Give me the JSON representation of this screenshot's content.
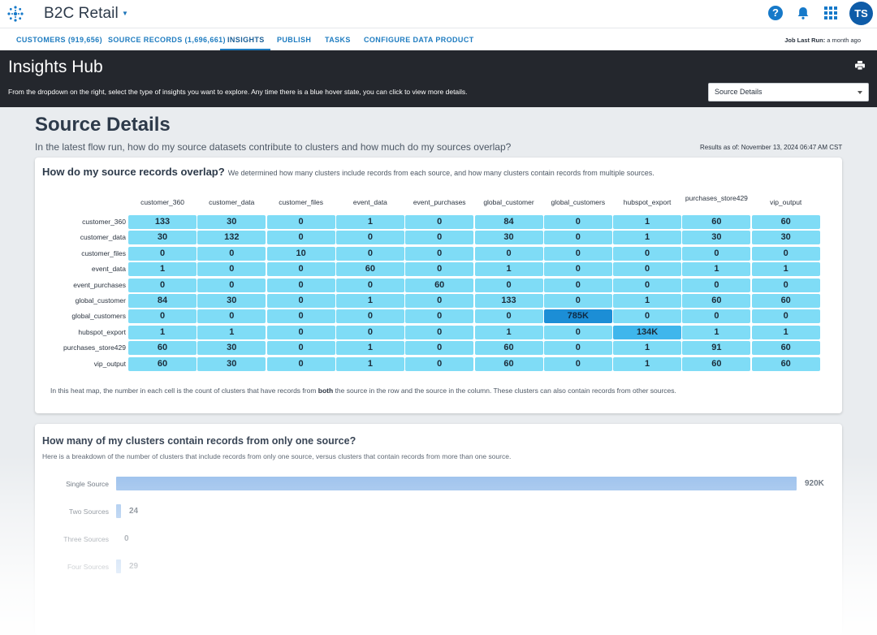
{
  "app": {
    "title": "B2C Retail",
    "user_initials": "TS",
    "accent_color": "#1679c9"
  },
  "nav": {
    "tabs": [
      {
        "label": "CUSTOMERS (919,656)"
      },
      {
        "label": "SOURCE RECORDS (1,696,661)"
      },
      {
        "label": "INSIGHTS",
        "active": true
      },
      {
        "label": "PUBLISH"
      },
      {
        "label": "TASKS"
      },
      {
        "label": "CONFIGURE DATA PRODUCT"
      }
    ],
    "job_run_label": "Job Last Run:",
    "job_run_value": "a month ago"
  },
  "hero": {
    "title": "Insights Hub",
    "description": "From the dropdown on the right, select the type of insights you want to explore. Any time there is a blue hover state, you can click to view more details.",
    "select_value": "Source Details"
  },
  "page": {
    "title": "Source Details",
    "subtitle": "In the latest flow run, how do my source datasets contribute to clusters and how much do my sources overlap?",
    "results_as_of": "Results as of: November 13, 2024 06:47 AM CST"
  },
  "overlap_card": {
    "heading": "How do my source records overlap?",
    "description": "We determined how many clusters include records from each source, and how many clusters contain records from multiple sources.",
    "note_before": "In this heat map, the number in each cell is the count of clusters that have records from ",
    "note_bold": "both",
    "note_after": " the source in the row and the source in the column. These clusters can also contain records from other sources.",
    "columns": [
      "customer_360",
      "customer_data",
      "customer_files",
      "event_data",
      "event_purchases",
      "global_customer",
      "global_customers",
      "hubspot_export",
      "purchases_store429",
      "vip_output"
    ],
    "rows": [
      {
        "label": "customer_360",
        "values": [
          "133",
          "30",
          "0",
          "1",
          "0",
          "84",
          "0",
          "1",
          "60",
          "60"
        ]
      },
      {
        "label": "customer_data",
        "values": [
          "30",
          "132",
          "0",
          "0",
          "0",
          "30",
          "0",
          "1",
          "30",
          "30"
        ]
      },
      {
        "label": "customer_files",
        "values": [
          "0",
          "0",
          "10",
          "0",
          "0",
          "0",
          "0",
          "0",
          "0",
          "0"
        ]
      },
      {
        "label": "event_data",
        "values": [
          "1",
          "0",
          "0",
          "60",
          "0",
          "1",
          "0",
          "0",
          "1",
          "1"
        ]
      },
      {
        "label": "event_purchases",
        "values": [
          "0",
          "0",
          "0",
          "0",
          "60",
          "0",
          "0",
          "0",
          "0",
          "0"
        ]
      },
      {
        "label": "global_customer",
        "values": [
          "84",
          "30",
          "0",
          "1",
          "0",
          "133",
          "0",
          "1",
          "60",
          "60"
        ]
      },
      {
        "label": "global_customers",
        "values": [
          "0",
          "0",
          "0",
          "0",
          "0",
          "0",
          "785K",
          "0",
          "0",
          "0"
        ]
      },
      {
        "label": "hubspot_export",
        "values": [
          "1",
          "1",
          "0",
          "0",
          "0",
          "1",
          "0",
          "134K",
          "1",
          "1"
        ]
      },
      {
        "label": "purchases_store429",
        "values": [
          "60",
          "30",
          "0",
          "1",
          "0",
          "60",
          "0",
          "1",
          "91",
          "60"
        ]
      },
      {
        "label": "vip_output",
        "values": [
          "60",
          "30",
          "0",
          "1",
          "0",
          "60",
          "0",
          "1",
          "60",
          "60"
        ]
      }
    ]
  },
  "single_source_card": {
    "heading": "How many of my clusters contain records from only one source?",
    "description": "Here is a breakdown of the number of clusters that include records from only one source, versus clusters that contain records from more than one source.",
    "bars": [
      {
        "label": "Single Source",
        "value_label": "920K",
        "value": 920000
      },
      {
        "label": "Two Sources",
        "value_label": "24",
        "value": 24
      },
      {
        "label": "Three Sources",
        "value_label": "0",
        "value": 0
      },
      {
        "label": "Four Sources",
        "value_label": "29",
        "value": 29
      }
    ]
  }
}
